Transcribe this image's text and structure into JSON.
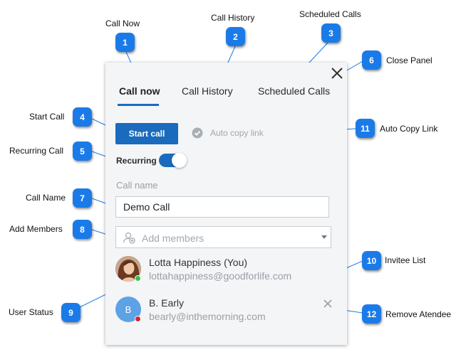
{
  "panel": {
    "tabs": [
      {
        "label": "Call now"
      },
      {
        "label": "Call History"
      },
      {
        "label": "Scheduled Calls"
      }
    ],
    "start_call_label": "Start call",
    "auto_copy_label": "Auto copy link",
    "recurring_label": "Recurring",
    "recurring_on": true,
    "call_name_label": "Call name",
    "call_name_value": "Demo Call",
    "members_placeholder": "Add members",
    "invitees": [
      {
        "name": "Lotta Happiness (You)",
        "email": "lottahappiness@goodforlife.com",
        "status_color": "#2ec24a"
      },
      {
        "name": "B. Early",
        "initial": "B",
        "email": "bearly@inthemorning.com",
        "status_color": "#d9262c"
      }
    ]
  },
  "callouts": [
    {
      "number": "1",
      "label": "Call Now"
    },
    {
      "number": "2",
      "label": "Call History"
    },
    {
      "number": "3",
      "label": "Scheduled Calls"
    },
    {
      "number": "4",
      "label": "Start Call"
    },
    {
      "number": "5",
      "label": "Recurring Call"
    },
    {
      "number": "6",
      "label": "Close Panel"
    },
    {
      "number": "7",
      "label": "Call Name"
    },
    {
      "number": "8",
      "label": "Add Members"
    },
    {
      "number": "9",
      "label": "User Status"
    },
    {
      "number": "10",
      "label": "Invitee List"
    },
    {
      "number": "11",
      "label": "Auto Copy Link"
    },
    {
      "number": "12",
      "label": "Remove Atendee"
    }
  ],
  "colors": {
    "accent": "#1a6bbd",
    "badge": "#1a7be8"
  }
}
